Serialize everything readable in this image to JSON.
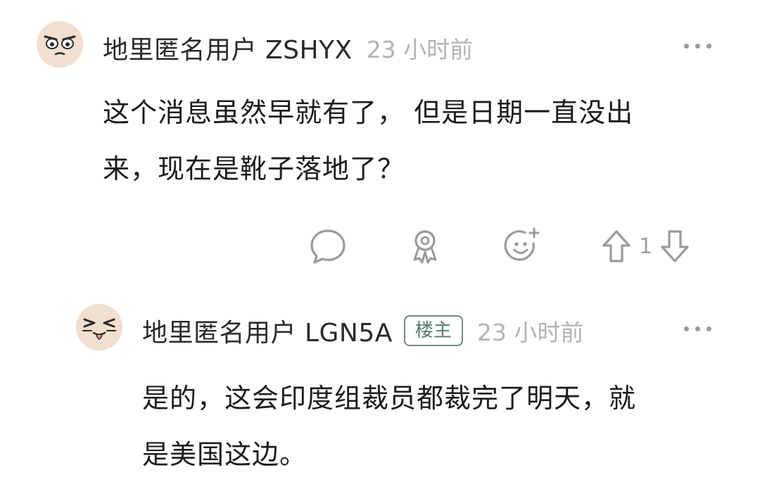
{
  "comment1": {
    "username": "地里匿名用户 ZSHYX",
    "time": "23 小时前",
    "body_line1": "这个消息虽然早就有了， 但是日期一直没出",
    "body_line2": "来，现在是靴子落地了？",
    "vote_count": "1",
    "avatar_icon": "dizzy-face-avatar"
  },
  "comment2": {
    "username": "地里匿名用户 LGN5A",
    "badge": "楼主",
    "time": "23 小时前",
    "body_line1": "是的，这会印度组裁员都裁完了明天，就",
    "body_line2": "是美国这边。",
    "avatar_icon": "laughing-face-avatar"
  },
  "colors": {
    "badge_border": "#6a8d85",
    "muted_text": "#b3b3b3",
    "icon_stroke": "#9a9a9a"
  }
}
